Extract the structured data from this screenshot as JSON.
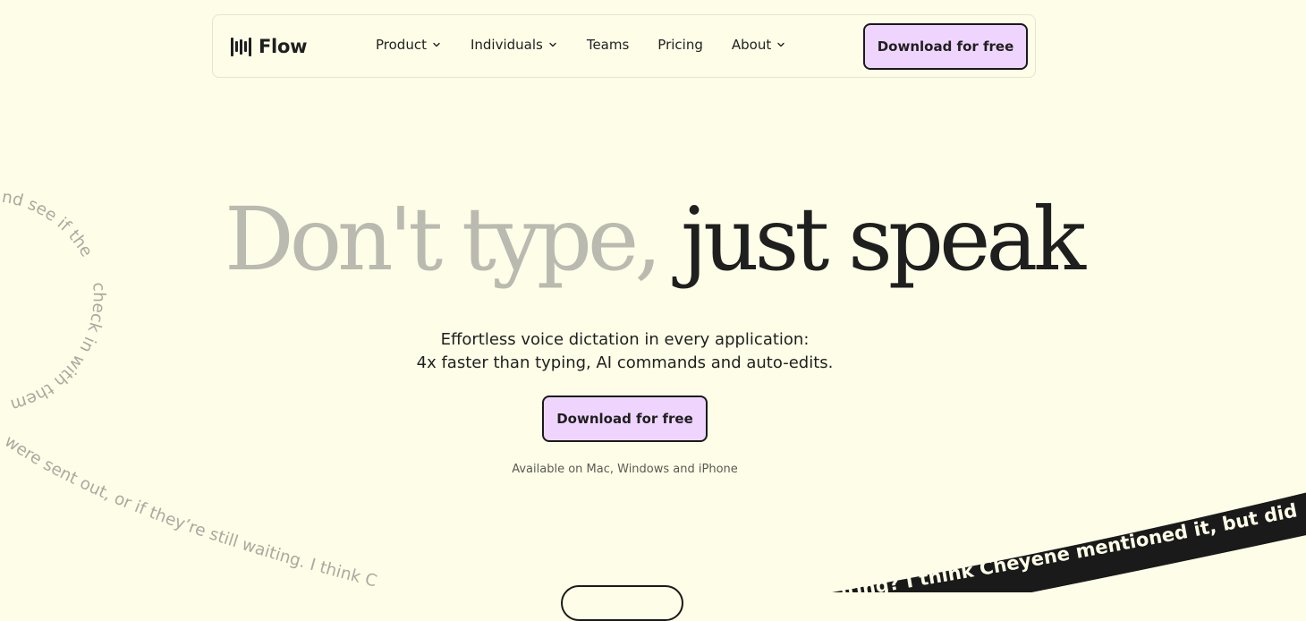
{
  "brand": {
    "name": "Flow",
    "logo_icon": "flow-bars-logo-icon"
  },
  "nav": {
    "items": [
      {
        "label": "Product",
        "has_dropdown": true
      },
      {
        "label": "Individuals",
        "has_dropdown": true
      },
      {
        "label": "Teams",
        "has_dropdown": false
      },
      {
        "label": "Pricing",
        "has_dropdown": false
      },
      {
        "label": "About",
        "has_dropdown": true
      }
    ],
    "cta_label": "Download for free",
    "dropdown_icon": "chevron-down-icon"
  },
  "hero": {
    "headline_light": "Don't type,",
    "headline_dark": "just speak",
    "subtitle_line1": "Effortless voice dictation in every application:",
    "subtitle_line2": "4x faster than typing, AI commands and auto-edits.",
    "cta_label": "Download for free",
    "availability": "Available on Mac, Windows and iPhone"
  },
  "decorative": {
    "curved_text_1": "and see if the",
    "curved_text_2": "check in with them",
    "curved_text_3": "were sent out, or if they’re still waiting. I think C",
    "band_text": "iting? I think Cheyene mentioned it, but did"
  },
  "colors": {
    "background": "#fefee8",
    "accent": "#efd5fd",
    "text": "#1f1f1f",
    "muted_heading": "#babab0",
    "decor_text": "#a9a9a0"
  }
}
